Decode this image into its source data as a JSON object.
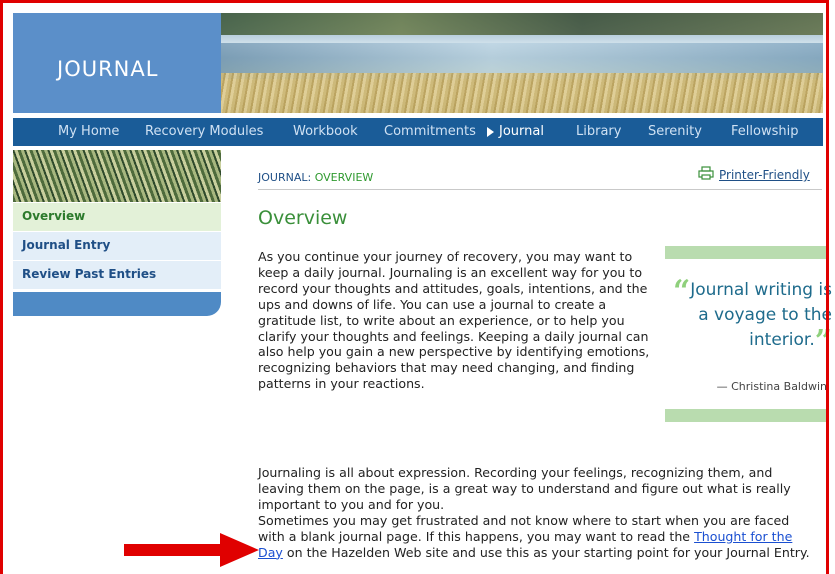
{
  "header": {
    "logo_text": "JOURNAL"
  },
  "nav": {
    "items": [
      {
        "label": "My Home"
      },
      {
        "label": "Recovery Modules"
      },
      {
        "label": "Workbook"
      },
      {
        "label": "Commitments"
      },
      {
        "label": "Journal",
        "active": true
      },
      {
        "label": "Library"
      },
      {
        "label": "Serenity"
      },
      {
        "label": "Fellowship"
      }
    ]
  },
  "sidebar": {
    "items": [
      {
        "label": "Overview",
        "active": true
      },
      {
        "label": "Journal Entry"
      },
      {
        "label": "Review Past Entries"
      }
    ]
  },
  "breadcrumb": {
    "prefix": "JOURNAL: ",
    "current": "OVERVIEW"
  },
  "printer": {
    "label": "Printer-Friendly",
    "icon": "printer-icon"
  },
  "main": {
    "title": "Overview",
    "para1": "As you continue your journey of recovery, you may want to keep a daily journal. Journaling is an excellent way for you to record your thoughts and attitudes, goals, intentions, and the ups and downs of life. You can use a journal to create a gratitude list, to write about an experience, or to help you clarify your thoughts and feelings. Keeping a daily journal can also help you gain a new perspective by identifying emotions, recognizing behaviors that may need changing, and finding patterns in your reactions.",
    "para2": "Journaling is all about expression. Recording your feelings, recognizing them, and leaving them on the page, is a great way to understand and figure out what is really important to you and for you.",
    "para3_before": "Sometimes you may get frustrated and not know where to start when you are faced with a blank journal page. If this happens, you may want to read the ",
    "para3_link": "Thought for the Day",
    "para3_after": " on the Hazelden Web site and use this as your starting point for your Journal Entry."
  },
  "quote": {
    "open_mark": "“",
    "text": "Journal writing is a voyage to the interior.",
    "close_mark": "”",
    "author": "— Christina Baldwin"
  },
  "colors": {
    "nav_bg": "#1a5c98",
    "logo_bg": "#5b8fc9",
    "accent_green": "#3a8f3a",
    "link_blue": "#1a4fd1",
    "annotation_red": "#e00000"
  }
}
